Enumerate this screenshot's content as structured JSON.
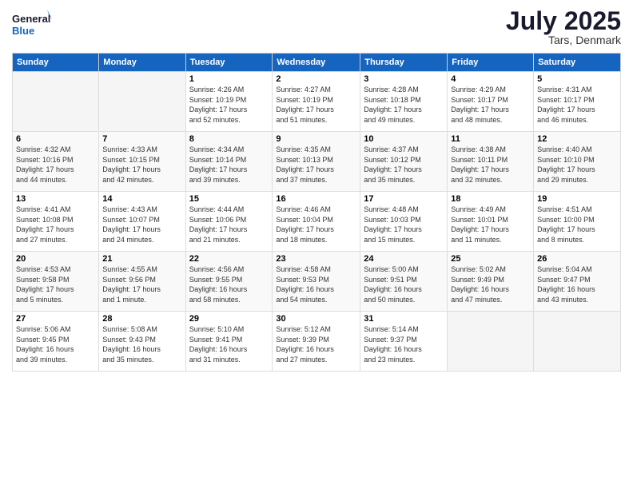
{
  "logo": {
    "line1": "General",
    "line2": "Blue"
  },
  "title": "July 2025",
  "subtitle": "Tars, Denmark",
  "headers": [
    "Sunday",
    "Monday",
    "Tuesday",
    "Wednesday",
    "Thursday",
    "Friday",
    "Saturday"
  ],
  "weeks": [
    [
      {
        "day": "",
        "info": ""
      },
      {
        "day": "",
        "info": ""
      },
      {
        "day": "1",
        "info": "Sunrise: 4:26 AM\nSunset: 10:19 PM\nDaylight: 17 hours\nand 52 minutes."
      },
      {
        "day": "2",
        "info": "Sunrise: 4:27 AM\nSunset: 10:19 PM\nDaylight: 17 hours\nand 51 minutes."
      },
      {
        "day": "3",
        "info": "Sunrise: 4:28 AM\nSunset: 10:18 PM\nDaylight: 17 hours\nand 49 minutes."
      },
      {
        "day": "4",
        "info": "Sunrise: 4:29 AM\nSunset: 10:17 PM\nDaylight: 17 hours\nand 48 minutes."
      },
      {
        "day": "5",
        "info": "Sunrise: 4:31 AM\nSunset: 10:17 PM\nDaylight: 17 hours\nand 46 minutes."
      }
    ],
    [
      {
        "day": "6",
        "info": "Sunrise: 4:32 AM\nSunset: 10:16 PM\nDaylight: 17 hours\nand 44 minutes."
      },
      {
        "day": "7",
        "info": "Sunrise: 4:33 AM\nSunset: 10:15 PM\nDaylight: 17 hours\nand 42 minutes."
      },
      {
        "day": "8",
        "info": "Sunrise: 4:34 AM\nSunset: 10:14 PM\nDaylight: 17 hours\nand 39 minutes."
      },
      {
        "day": "9",
        "info": "Sunrise: 4:35 AM\nSunset: 10:13 PM\nDaylight: 17 hours\nand 37 minutes."
      },
      {
        "day": "10",
        "info": "Sunrise: 4:37 AM\nSunset: 10:12 PM\nDaylight: 17 hours\nand 35 minutes."
      },
      {
        "day": "11",
        "info": "Sunrise: 4:38 AM\nSunset: 10:11 PM\nDaylight: 17 hours\nand 32 minutes."
      },
      {
        "day": "12",
        "info": "Sunrise: 4:40 AM\nSunset: 10:10 PM\nDaylight: 17 hours\nand 29 minutes."
      }
    ],
    [
      {
        "day": "13",
        "info": "Sunrise: 4:41 AM\nSunset: 10:08 PM\nDaylight: 17 hours\nand 27 minutes."
      },
      {
        "day": "14",
        "info": "Sunrise: 4:43 AM\nSunset: 10:07 PM\nDaylight: 17 hours\nand 24 minutes."
      },
      {
        "day": "15",
        "info": "Sunrise: 4:44 AM\nSunset: 10:06 PM\nDaylight: 17 hours\nand 21 minutes."
      },
      {
        "day": "16",
        "info": "Sunrise: 4:46 AM\nSunset: 10:04 PM\nDaylight: 17 hours\nand 18 minutes."
      },
      {
        "day": "17",
        "info": "Sunrise: 4:48 AM\nSunset: 10:03 PM\nDaylight: 17 hours\nand 15 minutes."
      },
      {
        "day": "18",
        "info": "Sunrise: 4:49 AM\nSunset: 10:01 PM\nDaylight: 17 hours\nand 11 minutes."
      },
      {
        "day": "19",
        "info": "Sunrise: 4:51 AM\nSunset: 10:00 PM\nDaylight: 17 hours\nand 8 minutes."
      }
    ],
    [
      {
        "day": "20",
        "info": "Sunrise: 4:53 AM\nSunset: 9:58 PM\nDaylight: 17 hours\nand 5 minutes."
      },
      {
        "day": "21",
        "info": "Sunrise: 4:55 AM\nSunset: 9:56 PM\nDaylight: 17 hours\nand 1 minute."
      },
      {
        "day": "22",
        "info": "Sunrise: 4:56 AM\nSunset: 9:55 PM\nDaylight: 16 hours\nand 58 minutes."
      },
      {
        "day": "23",
        "info": "Sunrise: 4:58 AM\nSunset: 9:53 PM\nDaylight: 16 hours\nand 54 minutes."
      },
      {
        "day": "24",
        "info": "Sunrise: 5:00 AM\nSunset: 9:51 PM\nDaylight: 16 hours\nand 50 minutes."
      },
      {
        "day": "25",
        "info": "Sunrise: 5:02 AM\nSunset: 9:49 PM\nDaylight: 16 hours\nand 47 minutes."
      },
      {
        "day": "26",
        "info": "Sunrise: 5:04 AM\nSunset: 9:47 PM\nDaylight: 16 hours\nand 43 minutes."
      }
    ],
    [
      {
        "day": "27",
        "info": "Sunrise: 5:06 AM\nSunset: 9:45 PM\nDaylight: 16 hours\nand 39 minutes."
      },
      {
        "day": "28",
        "info": "Sunrise: 5:08 AM\nSunset: 9:43 PM\nDaylight: 16 hours\nand 35 minutes."
      },
      {
        "day": "29",
        "info": "Sunrise: 5:10 AM\nSunset: 9:41 PM\nDaylight: 16 hours\nand 31 minutes."
      },
      {
        "day": "30",
        "info": "Sunrise: 5:12 AM\nSunset: 9:39 PM\nDaylight: 16 hours\nand 27 minutes."
      },
      {
        "day": "31",
        "info": "Sunrise: 5:14 AM\nSunset: 9:37 PM\nDaylight: 16 hours\nand 23 minutes."
      },
      {
        "day": "",
        "info": ""
      },
      {
        "day": "",
        "info": ""
      }
    ]
  ]
}
